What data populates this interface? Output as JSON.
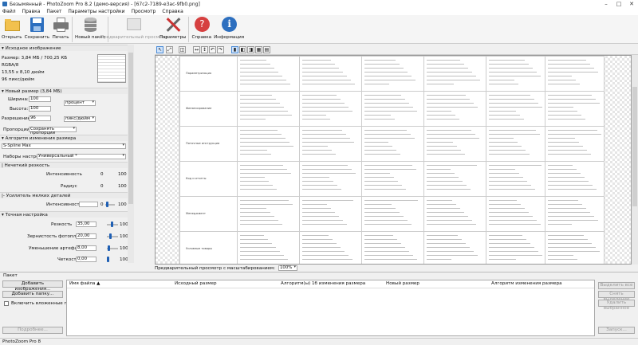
{
  "window": {
    "title": "Безымянный - PhotoZoom Pro 8.2 (демо-версия) - [67c2-7189-e3ac-9fb0.png]",
    "min": "–",
    "max": "□",
    "close": "✕"
  },
  "menu": [
    "Файл",
    "Правка",
    "Пакет",
    "Параметры настройки",
    "Просмотр",
    "Справка"
  ],
  "toolbar": {
    "open": "Открыть",
    "save": "Сохранить",
    "print": "Печать",
    "new_batch": "Новый пакет",
    "preset_preview": "Предварительный просмотр",
    "params": "Параметры",
    "help": "Справка",
    "info": "Информация"
  },
  "source": {
    "header": "Исходное изображение",
    "size": "Размер: 3,84 МБ / 700,25 КБ",
    "mode": "RGBA/8",
    "dims": "13,55 x 8,10 дюйм",
    "dpi": "96 пикс/дюйм"
  },
  "newsize": {
    "header": "Новый размер (3,84 МБ)",
    "width_label": "Ширина:",
    "width_val": "100",
    "width_unit": "процент",
    "height_label": "Высота:",
    "height_val": "100",
    "res_label": "Разрешение:",
    "res_val": "96",
    "res_unit": "пикс/дюйм",
    "prop_label": "Пропорции:",
    "prop_val": "Сохранять пропорции"
  },
  "algo": {
    "header": "Алгоритм изменения размера",
    "method": "S-Spline Max",
    "preset_label": "Наборы настроек:",
    "preset_val": "Универсальный *"
  },
  "sharp": {
    "header": "Нечеткий резкость",
    "intensity_label": "Интенсивность",
    "intensity_min": "0",
    "intensity_max": "100",
    "radius_label": "Радиус",
    "radius_min": "0",
    "radius_max": "100"
  },
  "detail": {
    "header": "Усилитель мелких деталей",
    "intensity_label": "Интенсивность",
    "intensity_min": "0",
    "intensity_max": "100"
  },
  "tuning": {
    "header": "Точная настройка",
    "sharpness_label": "Резкость",
    "sharpness_val": "35,00",
    "sharpness_max": "100",
    "film_label": "Зернистость фотопленки",
    "film_val": "20,00",
    "film_max": "100",
    "artifacts_label": "Уменьшение артефактов",
    "artifacts_val": "8,00",
    "artifacts_max": "100",
    "clarity_label": "Четкость",
    "clarity_val": "0,00",
    "clarity_max": "100",
    "extra_min": "0"
  },
  "preview": {
    "status_label": "Предварительный просмотр с масштабированием:",
    "zoom": "100%",
    "rows": [
      "Параметризация",
      "Финансирование",
      "Поточные инструкции",
      "Код и отчеты",
      "Менеджмент",
      "Условные товары"
    ]
  },
  "batch": {
    "header": "Пакет",
    "add_images": "Добавить изображения...",
    "add_folder": "Добавить папку...",
    "include_sub": "Включить вложенные папки",
    "apply": "Подробнее...",
    "cols": [
      "Имя файла ▲",
      "Исходный размер",
      "Алгоритм(ы) 1б изменения размера",
      "Новый размер",
      "Алгоритм изменения размера"
    ],
    "select_all": "Выделить все",
    "reset": "Снять выделение",
    "delete_selected": "Удалить выбранное",
    "run": "Запуск..."
  },
  "status": "PhotoZoom Pro 8",
  "colors": {
    "accent": "#1e5fb4",
    "page": "#f0f0f0"
  }
}
